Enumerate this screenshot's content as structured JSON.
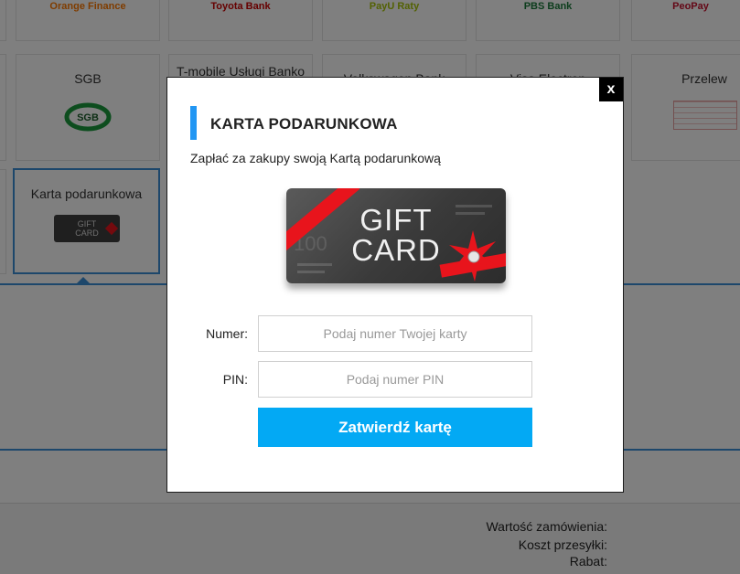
{
  "tiles_top": [
    {
      "label": "Orange Finance",
      "color": "#ff7900"
    },
    {
      "label": "Toyota Bank",
      "color": "#cc0000"
    },
    {
      "label": "PayU Raty",
      "color": "#a6c307"
    },
    {
      "label": "PBS Bank",
      "color": "#1a7a3a"
    },
    {
      "label": "PeoPay",
      "color": "#c8102e"
    }
  ],
  "tiles_mid": [
    {
      "label": "SGB"
    },
    {
      "label": "T-mobile Usługi Banko"
    },
    {
      "label": "Volkswagen Bank"
    },
    {
      "label": "Visa Electron"
    },
    {
      "label": "Przelew"
    }
  ],
  "tile_selected": {
    "label": "Karta podarunkowa",
    "logo_line1": "GIFT",
    "logo_line2": "CARD"
  },
  "sgb_logo_text": "SGB",
  "summary": {
    "order_value": "Wartość zamówienia:",
    "shipping": "Koszt przesyłki:",
    "discount": "Rabat:"
  },
  "modal": {
    "close": "x",
    "title": "KARTA PODARUNKOWA",
    "description": "Zapłać za zakupy swoją Kartą podarunkową",
    "card_line1": "GIFT",
    "card_line2": "CARD",
    "card_number": "100",
    "number_label": "Numer:",
    "number_placeholder": "Podaj numer Twojej karty",
    "pin_label": "PIN:",
    "pin_placeholder": "Podaj numer PIN",
    "submit": "Zatwierdź kartę"
  },
  "colors": {
    "accent": "#2196f3",
    "button": "#03a9f4",
    "ribbon": "#e8141c",
    "overlay": "rgba(0,0,0,0.5)"
  }
}
